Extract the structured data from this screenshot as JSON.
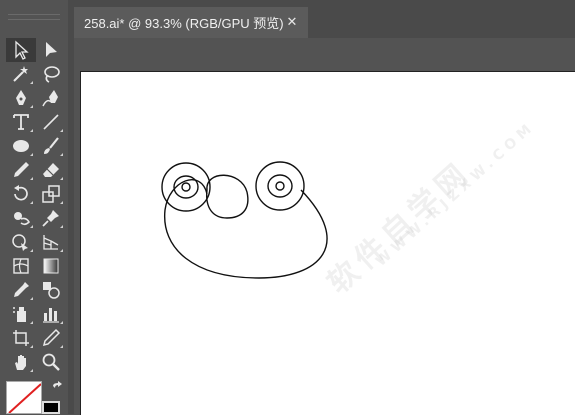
{
  "document_tab": {
    "title": "258.ai* @ 93.3% (RGB/GPU 预览)",
    "close_glyph": "✕"
  },
  "watermark": {
    "main": "软件自学网",
    "sub": "WWW.RJZXW.COM"
  },
  "tools": [
    {
      "name": "selection-tool",
      "icon": "arrow-outline-icon"
    },
    {
      "name": "direct-selection-tool",
      "icon": "arrow-filled-icon"
    },
    {
      "name": "magic-wand-tool",
      "icon": "magic-wand-icon"
    },
    {
      "name": "lasso-tool",
      "icon": "lasso-icon"
    },
    {
      "name": "pen-tool",
      "icon": "pen-icon"
    },
    {
      "name": "curvature-tool",
      "icon": "curvature-pen-icon"
    },
    {
      "name": "type-tool",
      "icon": "type-icon"
    },
    {
      "name": "line-segment-tool",
      "icon": "line-icon"
    },
    {
      "name": "ellipse-tool",
      "icon": "ellipse-icon"
    },
    {
      "name": "paintbrush-tool",
      "icon": "brush-icon"
    },
    {
      "name": "pencil-tool",
      "icon": "pencil-icon"
    },
    {
      "name": "eraser-tool",
      "icon": "eraser-icon"
    },
    {
      "name": "rotate-tool",
      "icon": "rotate-icon"
    },
    {
      "name": "scale-tool",
      "icon": "scale-icon"
    },
    {
      "name": "warp-tool",
      "icon": "warp-icon"
    },
    {
      "name": "puppet-warp-tool",
      "icon": "pin-icon"
    },
    {
      "name": "shape-builder-tool",
      "icon": "shape-builder-icon"
    },
    {
      "name": "perspective-grid-tool",
      "icon": "perspective-grid-icon"
    },
    {
      "name": "mesh-tool",
      "icon": "mesh-icon"
    },
    {
      "name": "gradient-tool",
      "icon": "gradient-icon"
    },
    {
      "name": "eyedropper-tool",
      "icon": "eyedropper-icon"
    },
    {
      "name": "blend-tool",
      "icon": "blend-icon"
    },
    {
      "name": "symbol-sprayer-tool",
      "icon": "symbol-sprayer-icon"
    },
    {
      "name": "column-graph-tool",
      "icon": "column-graph-icon"
    },
    {
      "name": "artboard-tool",
      "icon": "artboard-icon"
    },
    {
      "name": "slice-tool",
      "icon": "slice-icon"
    },
    {
      "name": "hand-tool",
      "icon": "hand-icon"
    },
    {
      "name": "zoom-tool",
      "icon": "zoom-icon"
    }
  ],
  "colors": {
    "ui_background": "#535353",
    "tab_active": "#5b5b5b",
    "artboard": "#ffffff",
    "stroke": "#000000",
    "fill": "#ffffff",
    "none_slash": "#e02020"
  }
}
